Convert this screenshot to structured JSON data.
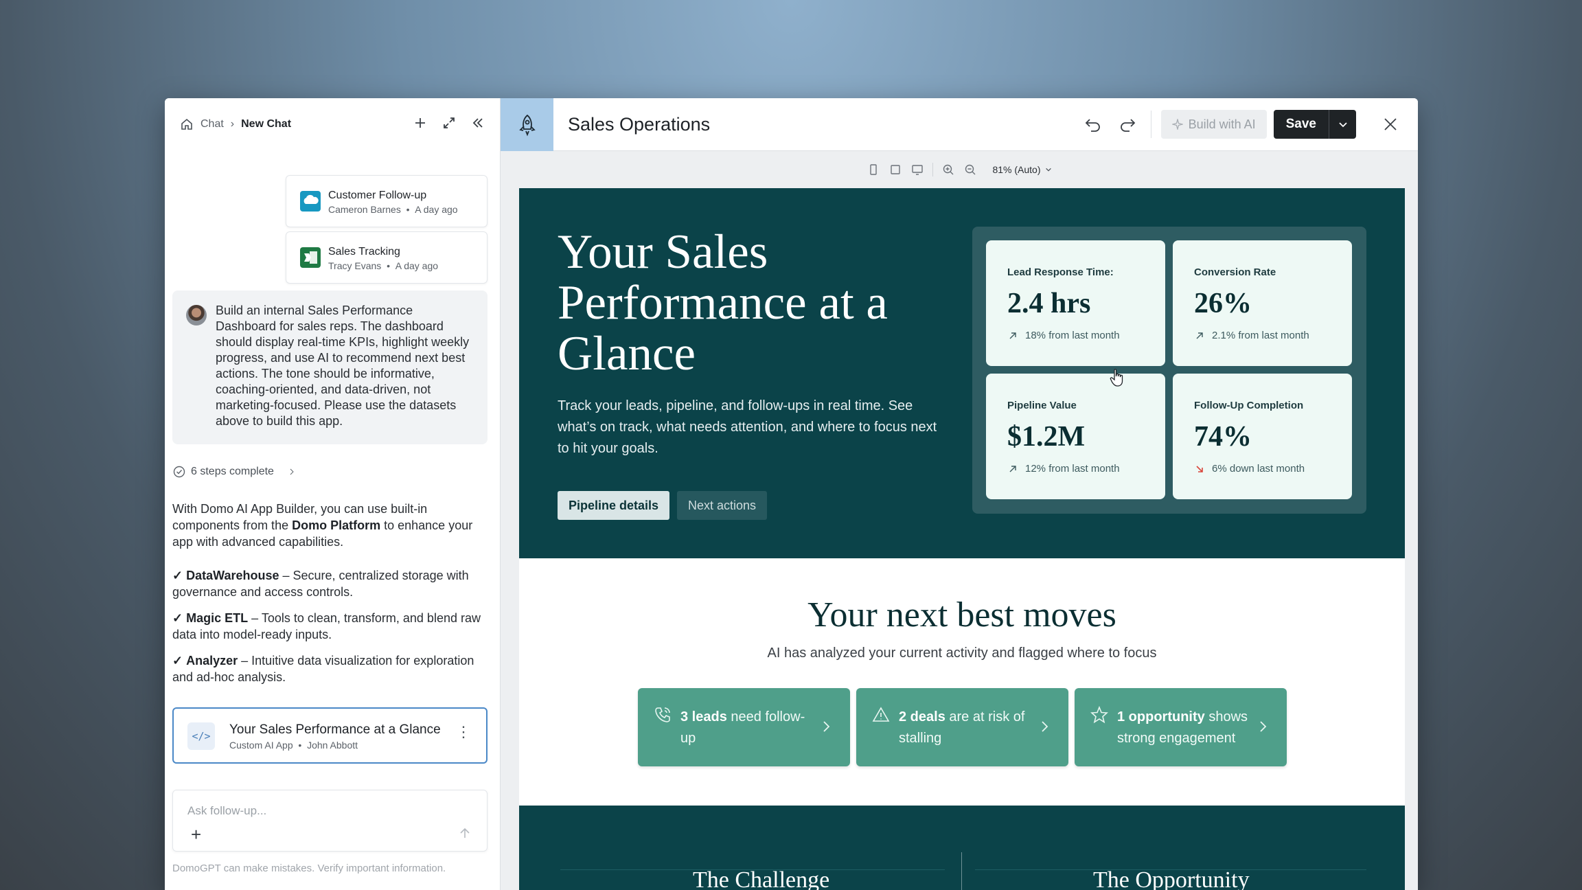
{
  "chat": {
    "breadcrumb": {
      "root": "Chat",
      "current": "New Chat"
    },
    "files": [
      {
        "name": "Customer Follow-up",
        "author": "Cameron Barnes",
        "time": "A day ago",
        "icon": "salesforce-icon"
      },
      {
        "name": "Sales Tracking",
        "author": "Tracy Evans",
        "time": "A day ago",
        "icon": "excel-icon"
      }
    ],
    "prompt": "Build an internal Sales Performance Dashboard for sales reps. The dashboard should display real-time KPIs, highlight weekly progress, and use AI to recommend next best actions. The tone should be informative, coaching-oriented, and data-driven, not marketing-focused. Please use the datasets above to build this app.",
    "steps": "6 steps complete",
    "answer_intro_pre": "With Domo AI App Builder, you can use built-in components from the ",
    "answer_intro_bold": "Domo Platform",
    "answer_intro_post": " to enhance your app with advanced capabilities.",
    "features": [
      {
        "name": "DataWarehouse",
        "desc": " – Secure, centralized storage with governance and access controls."
      },
      {
        "name": "Magic ETL",
        "desc": " – Tools to clean, transform, and blend raw data into model-ready inputs."
      },
      {
        "name": "Analyzer",
        "desc": " – Intuitive data visualization for exploration and ad-hoc analysis."
      }
    ],
    "check": "✓",
    "app_card": {
      "name": "Your Sales Performance at a Glance",
      "type": "Custom AI App",
      "author": "John Abbott",
      "dot": "•"
    },
    "composer_placeholder": "Ask follow-up...",
    "disclaimer": "DomoGPT can make mistakes. Verify important information."
  },
  "editor": {
    "title": "Sales Operations",
    "build_ai": "Build with AI",
    "save": "Save",
    "zoom": "81% (Auto)"
  },
  "app": {
    "hero_title": "Your Sales Performance at a Glance",
    "hero_sub": "Track your leads, pipeline, and follow-ups in real time. See what’s on track, what needs attention, and where to focus next to hit your goals.",
    "btn_pipeline": "Pipeline details",
    "btn_next": "Next actions",
    "kpis": [
      {
        "label": "Lead Response Time:",
        "value": "2.4 hrs",
        "trend": "18% from last month",
        "direction": "up"
      },
      {
        "label": "Conversion Rate",
        "value": "26%",
        "trend": "2.1% from last month",
        "direction": "up"
      },
      {
        "label": "Pipeline Value",
        "value": "$1.2M",
        "trend": "12% from last month",
        "direction": "up"
      },
      {
        "label": "Follow-Up Completion",
        "value": "74%",
        "trend": "6% down last month",
        "direction": "down"
      }
    ],
    "moves_title": "Your next best moves",
    "moves_sub": "AI has analyzed your current activity and flagged where to focus",
    "moves": [
      {
        "bold": "3 leads",
        "rest": " need follow-up",
        "icon": "phone-icon"
      },
      {
        "bold": "2 deals",
        "rest": " are at risk of stalling",
        "icon": "warning-icon"
      },
      {
        "bold": "1 opportunity",
        "rest": " shows strong engagement",
        "icon": "star-icon"
      }
    ],
    "challenge": "The Challenge",
    "opportunity": "The Opportunity"
  },
  "colors": {
    "hero_bg": "#0b4349",
    "kpi_card": "#eef9f5",
    "move_card": "#4f9f8a",
    "trend_down": "#d9453a",
    "selection_border": "#4a88c7"
  }
}
